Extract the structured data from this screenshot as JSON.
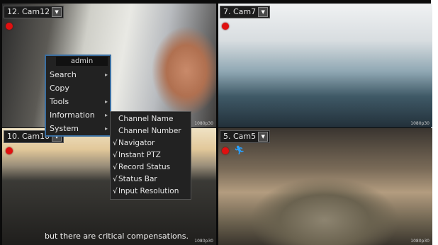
{
  "tiles": {
    "cam12": {
      "title": "12. Cam12",
      "resolution": "1080p30"
    },
    "cam7": {
      "title": "7. Cam7",
      "resolution": "1080p30"
    },
    "cam10": {
      "title": "10. Cam10",
      "resolution": "1080p30",
      "caption": "but there are critical compensations."
    },
    "cam5": {
      "title": "5. Cam5",
      "resolution": "1080p30"
    }
  },
  "context_menu": {
    "user": "admin",
    "items": [
      {
        "label": "Search",
        "has_submenu": true
      },
      {
        "label": "Copy",
        "has_submenu": false
      },
      {
        "label": "Tools",
        "has_submenu": true
      },
      {
        "label": "Information",
        "has_submenu": true
      },
      {
        "label": "System",
        "has_submenu": true
      }
    ]
  },
  "submenu": {
    "items": [
      {
        "label": "Channel Name",
        "checked": false
      },
      {
        "label": "Channel Number",
        "checked": false
      },
      {
        "label": "Navigator",
        "checked": true
      },
      {
        "label": "Instant PTZ",
        "checked": true
      },
      {
        "label": "Record Status",
        "checked": true
      },
      {
        "label": "Status Bar",
        "checked": true
      },
      {
        "label": "Input Resolution",
        "checked": true
      }
    ],
    "check_glyph": "√"
  },
  "icons": {
    "dropdown": "chevron-down-icon",
    "record": "record-indicator-icon",
    "motion": "motion-detect-icon",
    "submenu": "chevron-right-icon"
  },
  "colors": {
    "record": "#e01010",
    "menu_border": "#3a6ea0",
    "motion": "#2aa0ff"
  }
}
